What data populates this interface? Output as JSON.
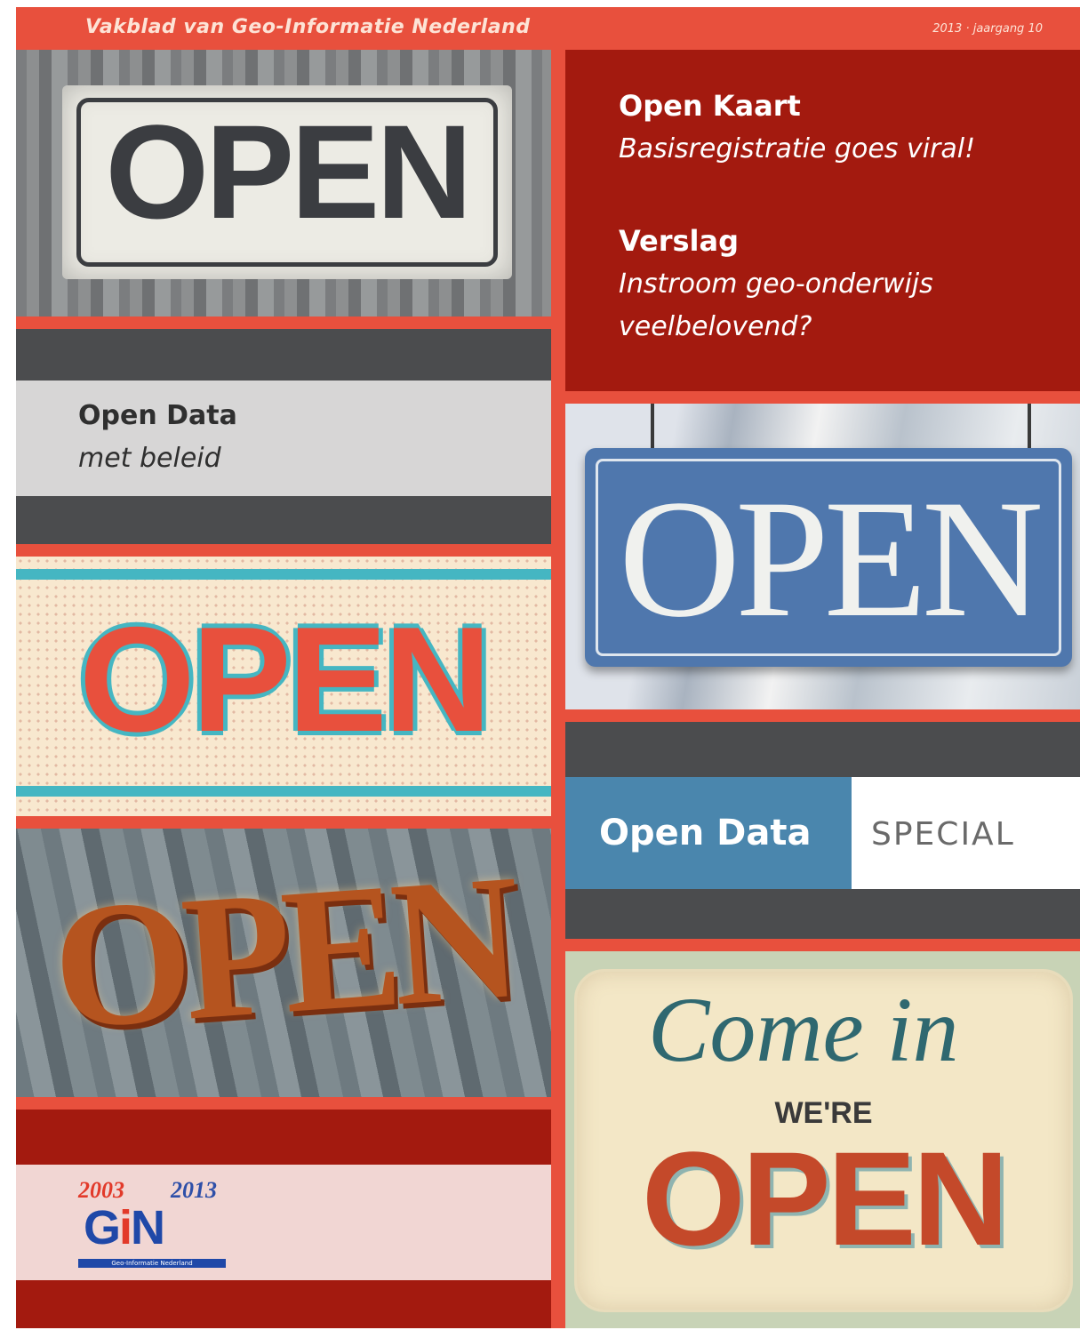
{
  "header": {
    "title": "Vakblad van Geo-Informatie Nederland",
    "issue": "2013 · jaargang 10"
  },
  "photo_signs": {
    "wood_sign": "OPEN",
    "retro_sign": "OPEN",
    "marquee_sign": "OPEN",
    "blue_sign": "OPEN"
  },
  "toc": {
    "item1_title": "Open Kaart",
    "item1_sub": "Basisregistratie goes viral!",
    "item2_title": "Verslag",
    "item2_sub_line1": "Instroom geo-onderwijs",
    "item2_sub_line2": "veelbelovend?"
  },
  "feature": {
    "title": "Open Data",
    "sub": "met beleid"
  },
  "special": {
    "label": "Open Data",
    "tag": "SPECIAL"
  },
  "come_in_sign": {
    "script": "Come in",
    "were": "WE'RE",
    "open": "OPEN"
  },
  "logo": {
    "year_start": "2003",
    "year_end": "2013",
    "mark_g": "G",
    "mark_i": "i",
    "mark_n": "N",
    "tagline": "Geo-Informatie Nederland"
  },
  "colors": {
    "coral": "#e8503d",
    "dark_red": "#a31a0f",
    "charcoal": "#4b4c4e",
    "steel_blue": "#4a86ad"
  }
}
